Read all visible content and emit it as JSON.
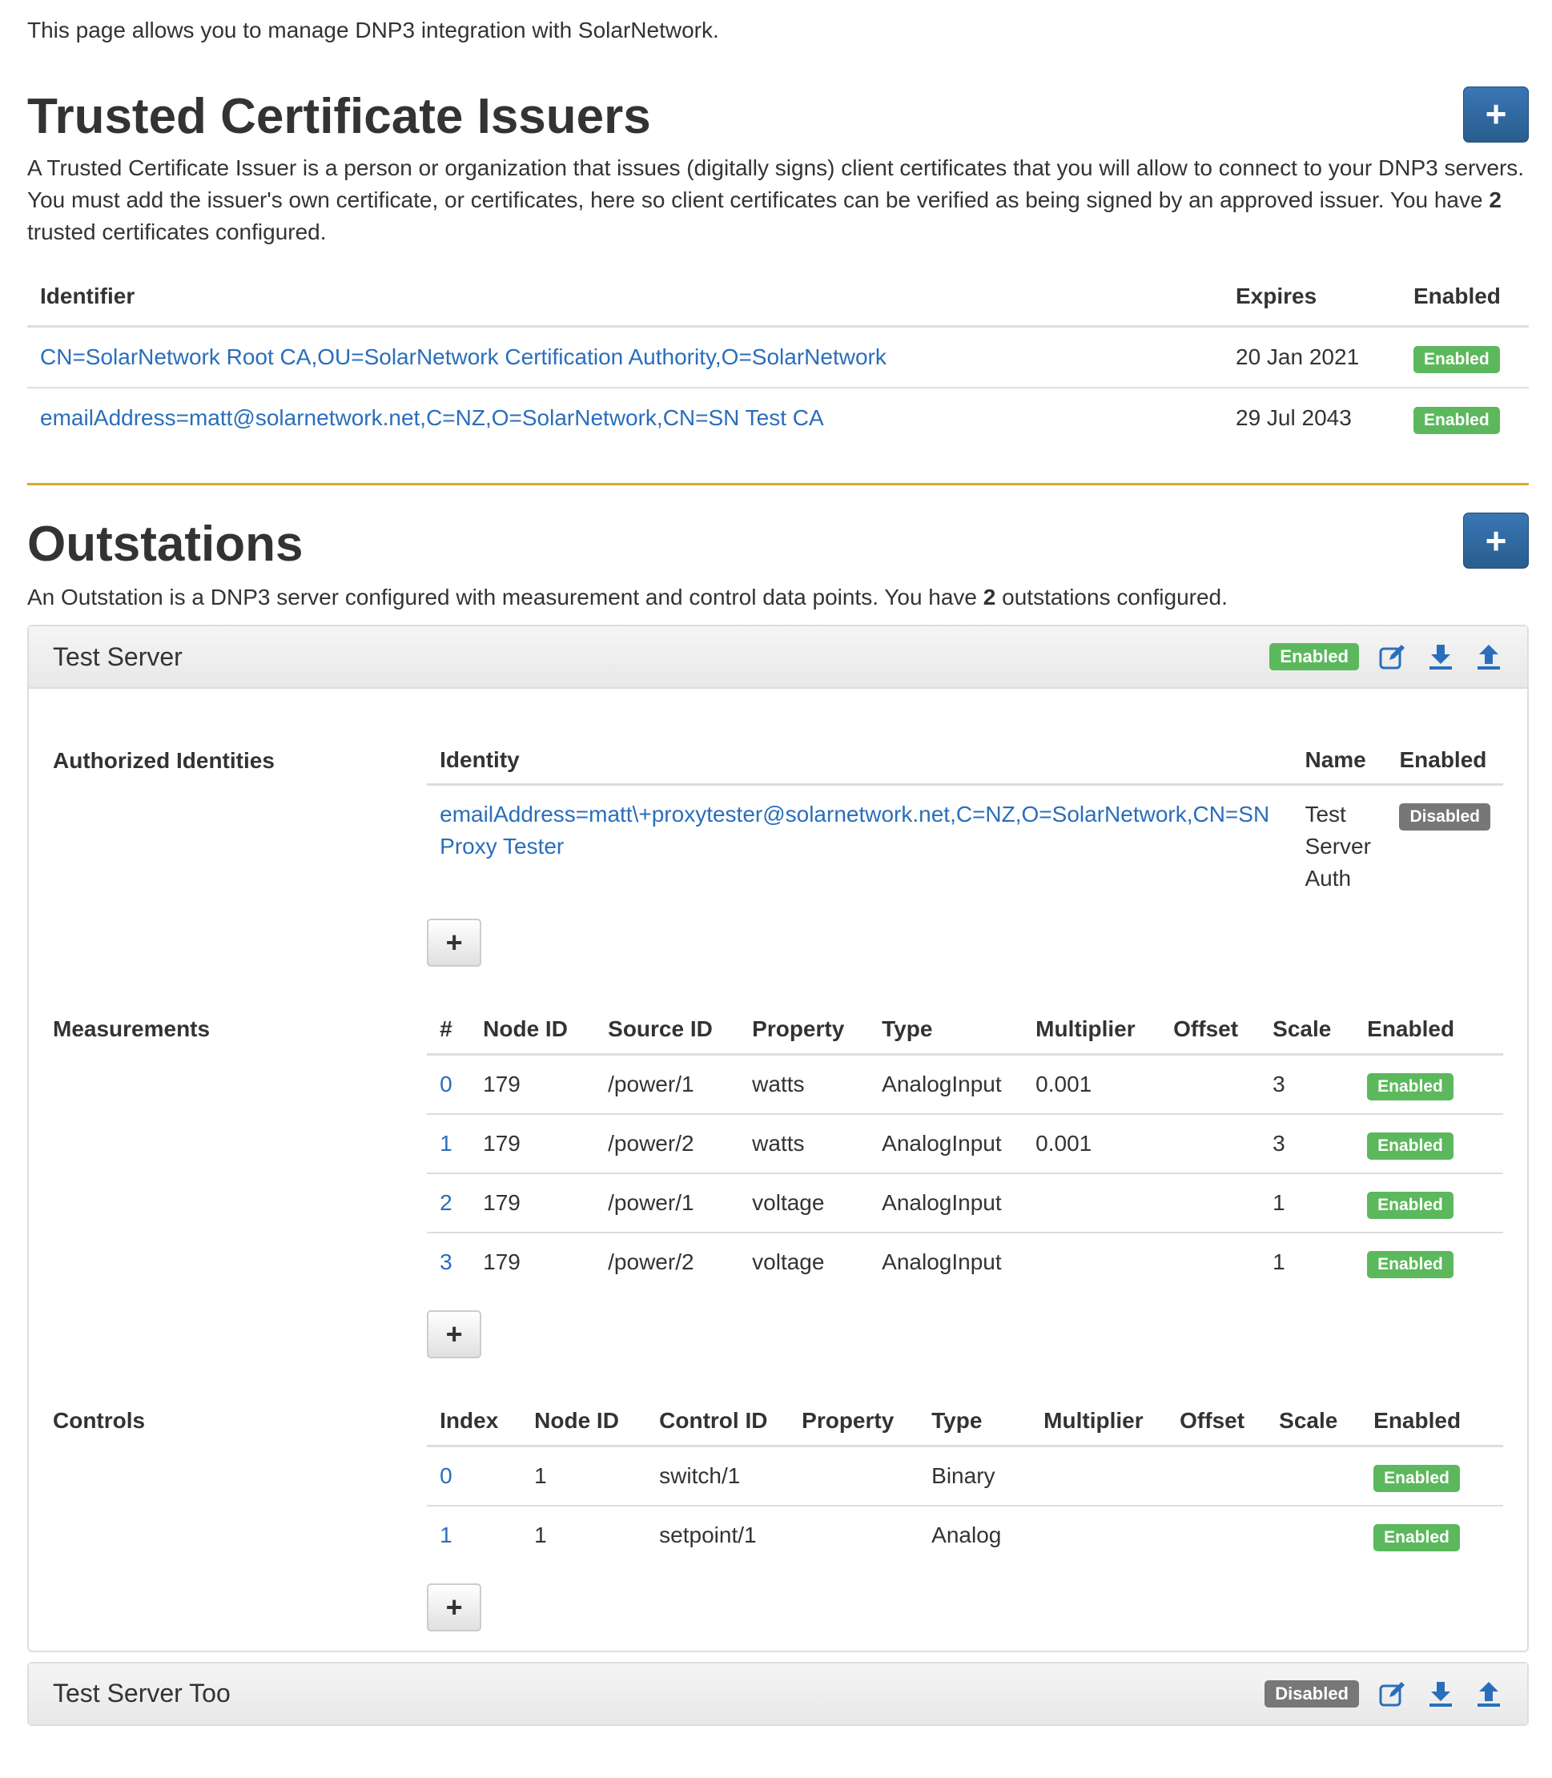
{
  "intro": "This page allows you to manage DNP3 integration with SolarNetwork.",
  "issuers": {
    "title": "Trusted Certificate Issuers",
    "desc_before": "A Trusted Certificate Issuer is a person or organization that issues (digitally signs) client certificates that you will allow to connect to your DNP3 servers. You must add the issuer's own certificate, or certificates, here so client certificates can be verified as being signed by an approved issuer. You have",
    "count": "2",
    "desc_after": "trusted certificates configured.",
    "columns": [
      "Identifier",
      "Expires",
      "Enabled"
    ],
    "rows": [
      {
        "identifier": "CN=SolarNetwork Root CA,OU=SolarNetwork Certification Authority,O=SolarNetwork",
        "expires": "20 Jan 2021",
        "enabled": "Enabled"
      },
      {
        "identifier": "emailAddress=matt@solarnetwork.net,C=NZ,O=SolarNetwork,CN=SN Test CA",
        "expires": "29 Jul 2043",
        "enabled": "Enabled"
      }
    ]
  },
  "outstations": {
    "title": "Outstations",
    "desc_before": "An Outstation is a DNP3 server configured with measurement and control data points. You have",
    "count": "2",
    "desc_after": "outstations configured.",
    "servers": [
      {
        "name": "Test Server",
        "status": "Enabled",
        "auth": {
          "label": "Authorized Identities",
          "columns": [
            "Identity",
            "Name",
            "Enabled"
          ],
          "identity": "emailAddress=matt\\+proxytester@solarnetwork.net,C=NZ,O=SolarNetwork,CN=SN Proxy Tester",
          "name": "Test Server Auth",
          "enabled": "Disabled"
        },
        "measurements": {
          "label": "Measurements",
          "columns": [
            "#",
            "Node ID",
            "Source ID",
            "Property",
            "Type",
            "Multiplier",
            "Offset",
            "Scale",
            "Enabled"
          ],
          "rows": [
            {
              "index": "0",
              "node": "179",
              "source": "/power/1",
              "property": "watts",
              "type": "AnalogInput",
              "multiplier": "0.001",
              "offset": "",
              "scale": "3",
              "enabled": "Enabled"
            },
            {
              "index": "1",
              "node": "179",
              "source": "/power/2",
              "property": "watts",
              "type": "AnalogInput",
              "multiplier": "0.001",
              "offset": "",
              "scale": "3",
              "enabled": "Enabled"
            },
            {
              "index": "2",
              "node": "179",
              "source": "/power/1",
              "property": "voltage",
              "type": "AnalogInput",
              "multiplier": "",
              "offset": "",
              "scale": "1",
              "enabled": "Enabled"
            },
            {
              "index": "3",
              "node": "179",
              "source": "/power/2",
              "property": "voltage",
              "type": "AnalogInput",
              "multiplier": "",
              "offset": "",
              "scale": "1",
              "enabled": "Enabled"
            }
          ]
        },
        "controls": {
          "label": "Controls",
          "columns": [
            "Index",
            "Node ID",
            "Control ID",
            "Property",
            "Type",
            "Multiplier",
            "Offset",
            "Scale",
            "Enabled"
          ],
          "rows": [
            {
              "index": "0",
              "node": "1",
              "control": "switch/1",
              "property": "",
              "type": "Binary",
              "multiplier": "",
              "offset": "",
              "scale": "",
              "enabled": "Enabled"
            },
            {
              "index": "1",
              "node": "1",
              "control": "setpoint/1",
              "property": "",
              "type": "Analog",
              "multiplier": "",
              "offset": "",
              "scale": "",
              "enabled": "Enabled"
            }
          ]
        }
      },
      {
        "name": "Test Server Too",
        "status": "Disabled"
      }
    ]
  },
  "icons": {
    "add": "plus-icon",
    "edit": "edit-icon",
    "export": "download-icon",
    "import": "upload-icon"
  },
  "colors": {
    "primary": "#2a6ebb",
    "success": "#5cb85c",
    "disabled": "#777777",
    "accent_rule": "#d8a92e"
  }
}
